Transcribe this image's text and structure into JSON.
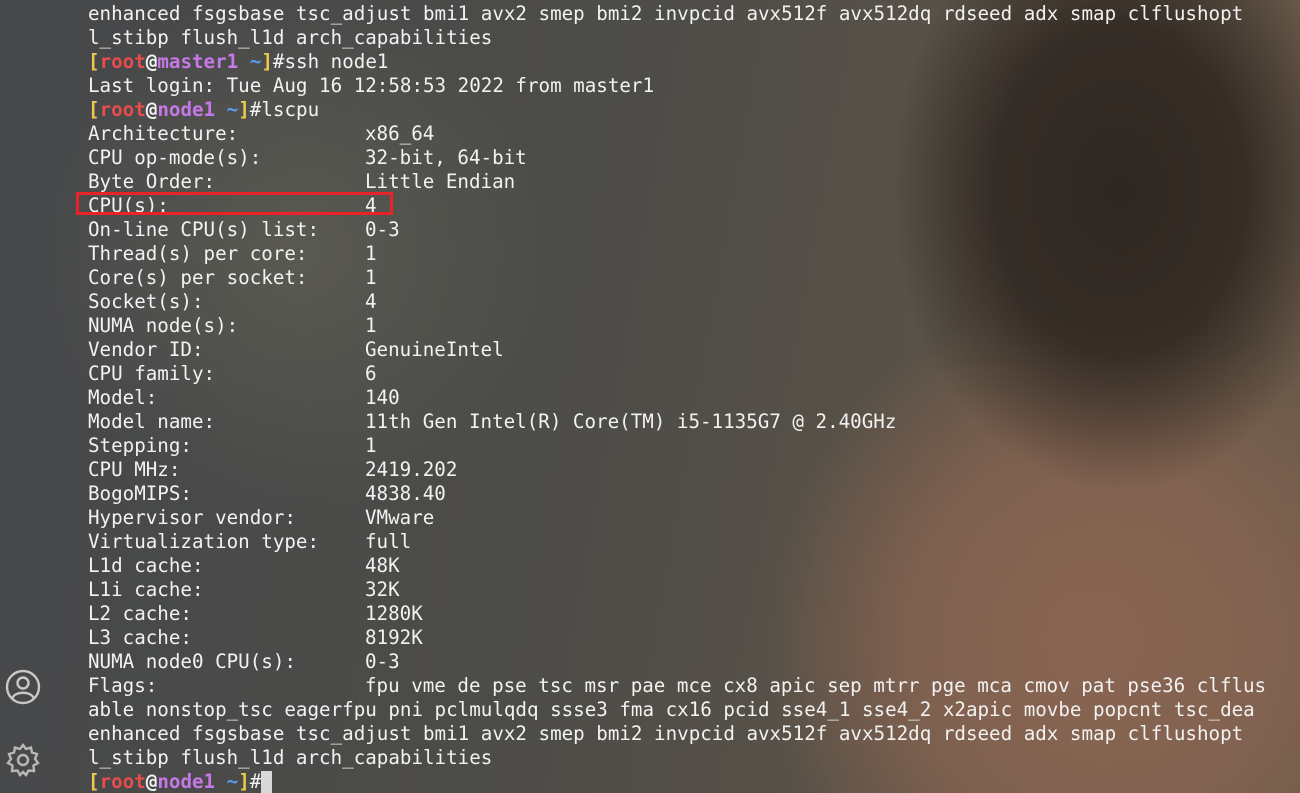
{
  "terminal": {
    "lines": [
      {
        "type": "text",
        "text": "enhanced fsgsbase tsc_adjust bmi1 avx2 smep bmi2 invpcid avx512f avx512dq rdseed adx smap clflushopt"
      },
      {
        "type": "text",
        "text": "l_stibp flush_l1d arch_capabilities"
      },
      {
        "type": "prompt",
        "user": "root",
        "host": "master1",
        "path": "~",
        "command": "ssh node1"
      },
      {
        "type": "text",
        "text": "Last login: Tue Aug 16 12:58:53 2022 from master1"
      },
      {
        "type": "prompt",
        "user": "root",
        "host": "node1",
        "path": "~",
        "command": "lscpu"
      },
      {
        "type": "kv",
        "key": "Architecture:",
        "value": "x86_64"
      },
      {
        "type": "kv",
        "key": "CPU op-mode(s):",
        "value": "32-bit, 64-bit"
      },
      {
        "type": "kv",
        "key": "Byte Order:",
        "value": "Little Endian"
      },
      {
        "type": "kv",
        "key": "CPU(s):",
        "value": "4"
      },
      {
        "type": "kv",
        "key": "On-line CPU(s) list:",
        "value": "0-3"
      },
      {
        "type": "kv",
        "key": "Thread(s) per core:",
        "value": "1"
      },
      {
        "type": "kv",
        "key": "Core(s) per socket:",
        "value": "1"
      },
      {
        "type": "kv",
        "key": "Socket(s):",
        "value": "4"
      },
      {
        "type": "kv",
        "key": "NUMA node(s):",
        "value": "1"
      },
      {
        "type": "kv",
        "key": "Vendor ID:",
        "value": "GenuineIntel"
      },
      {
        "type": "kv",
        "key": "CPU family:",
        "value": "6"
      },
      {
        "type": "kv",
        "key": "Model:",
        "value": "140"
      },
      {
        "type": "kv",
        "key": "Model name:",
        "value": "11th Gen Intel(R) Core(TM) i5-1135G7 @ 2.40GHz"
      },
      {
        "type": "kv",
        "key": "Stepping:",
        "value": "1"
      },
      {
        "type": "kv",
        "key": "CPU MHz:",
        "value": "2419.202"
      },
      {
        "type": "kv",
        "key": "BogoMIPS:",
        "value": "4838.40"
      },
      {
        "type": "kv",
        "key": "Hypervisor vendor:",
        "value": "VMware"
      },
      {
        "type": "kv",
        "key": "Virtualization type:",
        "value": "full"
      },
      {
        "type": "kv",
        "key": "L1d cache:",
        "value": "48K"
      },
      {
        "type": "kv",
        "key": "L1i cache:",
        "value": "32K"
      },
      {
        "type": "kv",
        "key": "L2 cache:",
        "value": "1280K"
      },
      {
        "type": "kv",
        "key": "L3 cache:",
        "value": "8192K"
      },
      {
        "type": "kv",
        "key": "NUMA node0 CPU(s):",
        "value": "0-3"
      },
      {
        "type": "kv",
        "key": "Flags:",
        "value": "fpu vme de pse tsc msr pae mce cx8 apic sep mtrr pge mca cmov pat pse36 clflus"
      },
      {
        "type": "text",
        "text": "able nonstop_tsc eagerfpu pni pclmulqdq ssse3 fma cx16 pcid sse4_1 sse4_2 x2apic movbe popcnt tsc_dea"
      },
      {
        "type": "text",
        "text": "enhanced fsgsbase tsc_adjust bmi1 avx2 smep bmi2 invpcid avx512f avx512dq rdseed adx smap clflushopt"
      },
      {
        "type": "text",
        "text": "l_stibp flush_l1d arch_capabilities"
      },
      {
        "type": "prompt",
        "user": "root",
        "host": "node1",
        "path": "~",
        "command": "",
        "cursor": true
      }
    ]
  },
  "highlight": {
    "target": "CPU(s):",
    "color": "#e8232a"
  },
  "side_icons": [
    {
      "name": "user-icon"
    },
    {
      "name": "gear-icon"
    }
  ],
  "colors": {
    "text": "#f2f2f2",
    "prompt_bracket": "#f0c94b",
    "prompt_user": "#e84c4c",
    "prompt_host": "#c678e6",
    "prompt_path": "#5a9ef0"
  }
}
